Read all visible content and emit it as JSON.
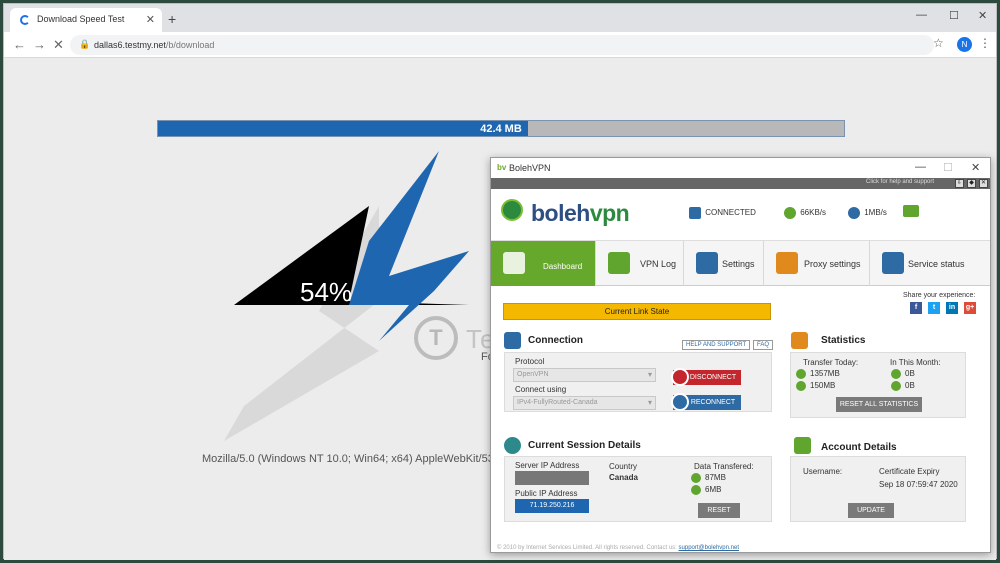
{
  "browser": {
    "tab_title": "Download Speed Test",
    "tab_close": "✕",
    "new_tab": "+",
    "url_host": "dallas6.testmy.net",
    "url_path": "/b/download",
    "profile_initial": "N",
    "window_controls": {
      "minimize": "—",
      "maximize": "☐",
      "close": "✕"
    }
  },
  "page": {
    "downloaded": "42.4 MB",
    "progress_fraction": 0.54,
    "percent_text": "54%",
    "partial_text": "Fo",
    "user_agent": "Mozilla/5.0 (Windows NT 10.0; Win64; x64) AppleWebKit/53"
  },
  "watermark": {
    "letter": "T",
    "text": "TechNadu"
  },
  "vpn": {
    "window_title": "BolehVPN",
    "window_logo": "bv",
    "window_controls": {
      "minimize": "—",
      "maximize": "☐",
      "close": "✕"
    },
    "help_text": "Click for help and support",
    "brand_a": "boleh",
    "brand_b": "vpn",
    "status": {
      "connected": "CONNECTED",
      "download": "66KB/s",
      "upload": "1MB/s"
    },
    "tabs": [
      {
        "label": "Dashboard"
      },
      {
        "label": "VPN Log"
      },
      {
        "label": "Settings"
      },
      {
        "label": "Proxy settings"
      },
      {
        "label": "Service status"
      }
    ],
    "share_text": "Share your experience:",
    "social": [
      "f",
      "t",
      "in",
      "g+"
    ],
    "link_state": "Current Link State",
    "connection": {
      "title": "Connection",
      "help_btn": "HELP AND SUPPORT",
      "faq_btn": "FAQ",
      "protocol_label": "Protocol",
      "protocol_value": "OpenVPN",
      "connect_using_label": "Connect using",
      "connect_using_value": "IPv4-FullyRouted-Canada",
      "disconnect": "DISCONNECT",
      "reconnect": "RECONNECT"
    },
    "statistics": {
      "title": "Statistics",
      "today_label": "Transfer Today:",
      "month_label": "In This Month:",
      "today_down": "1357MB",
      "today_up": "150MB",
      "month_down": "0B",
      "month_up": "0B",
      "reset_all": "RESET ALL STATISTICS"
    },
    "session": {
      "title": "Current Session Details",
      "server_ip_label": "Server IP Address",
      "public_ip_label": "Public IP Address",
      "public_ip": "71.19.250.216",
      "country_label": "Country",
      "country": "Canada",
      "data_label": "Data Transfered:",
      "data_down": "87MB",
      "data_up": "6MB",
      "reset": "RESET"
    },
    "account": {
      "title": "Account Details",
      "username_label": "Username:",
      "cert_label": "Certificate Expiry",
      "cert_value": "Sep 18 07:59:47 2020",
      "update": "UPDATE"
    },
    "footer_text": "© 2010 by Internet Services Limited. All rights reserved. Contact us:",
    "footer_email": "support@bolehvpn.net"
  }
}
